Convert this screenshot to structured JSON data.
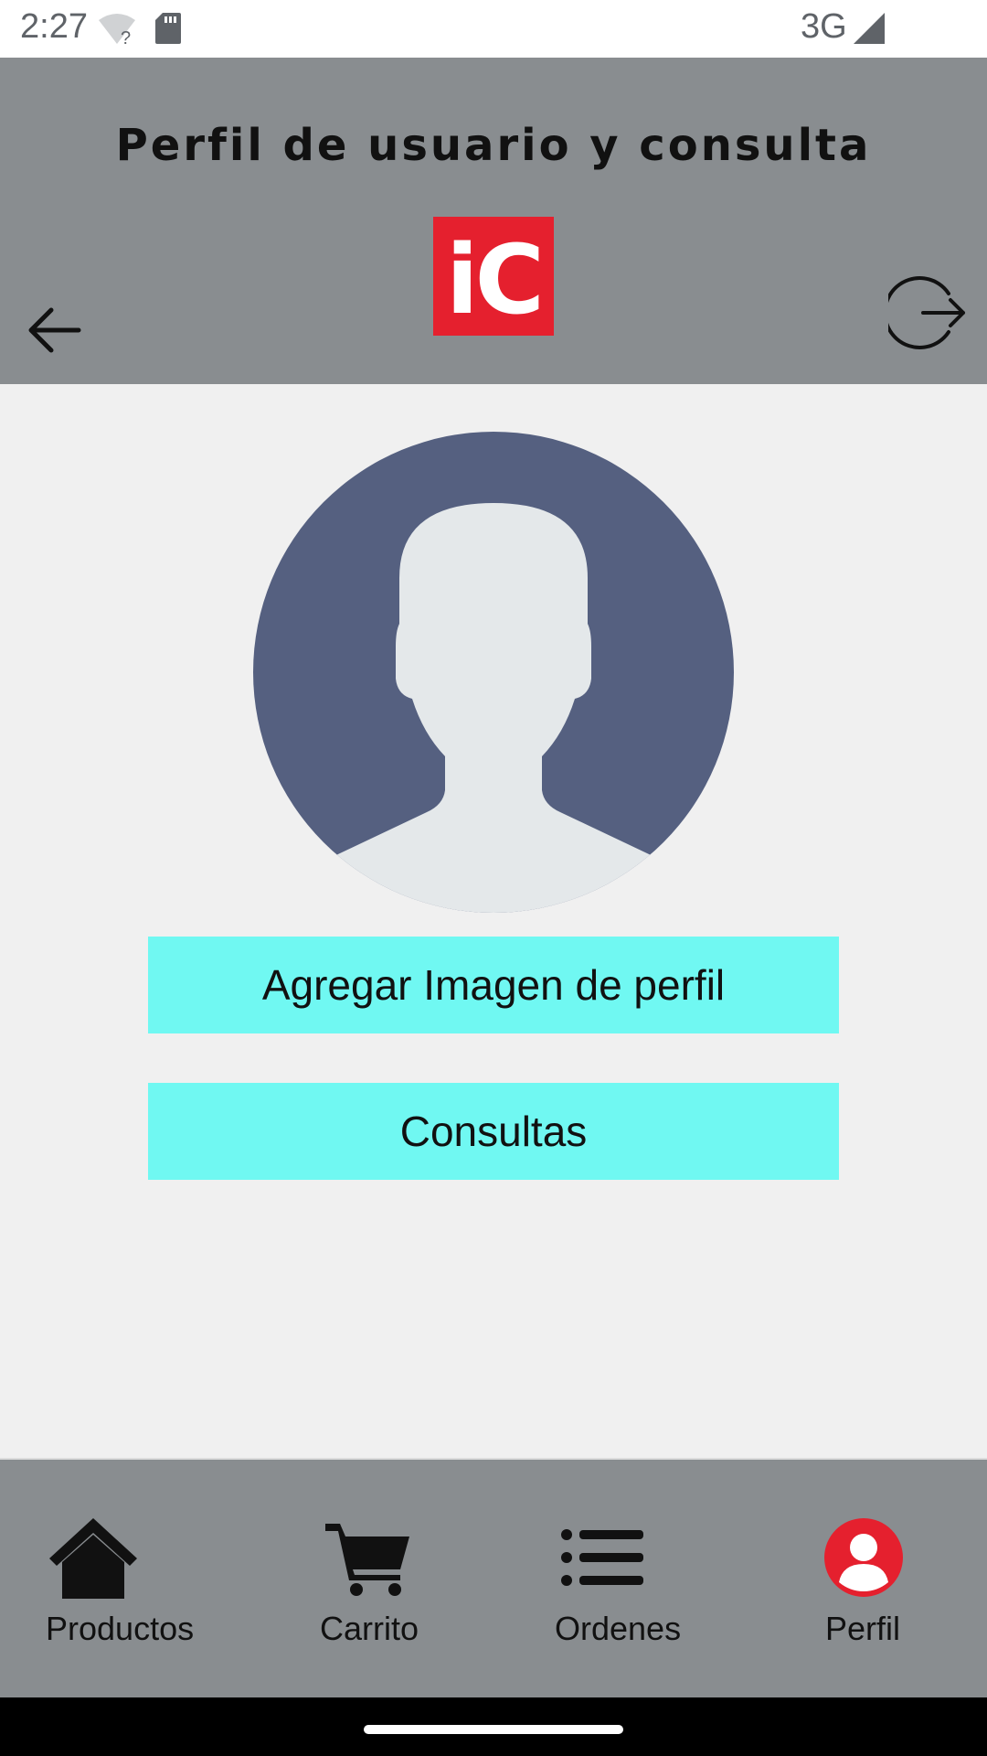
{
  "status_bar": {
    "time": "2:27",
    "network": "3G",
    "icons": [
      "wifi-unknown-icon",
      "sd-card-icon",
      "signal-icon"
    ]
  },
  "header": {
    "title": "Perfil de usuario y consulta",
    "logo_text": "iC",
    "back_icon": "arrow-left-icon",
    "logout_icon": "logout-icon"
  },
  "profile": {
    "avatar_icon": "default-user-avatar"
  },
  "buttons": {
    "add_image": "Agregar Imagen de perfil",
    "consultas": "Consultas"
  },
  "bottom_nav": {
    "items": [
      {
        "label": "Productos",
        "icon": "home-icon",
        "active": false
      },
      {
        "label": "Carrito",
        "icon": "cart-icon",
        "active": false
      },
      {
        "label": "Ordenes",
        "icon": "list-icon",
        "active": false
      },
      {
        "label": "Perfil",
        "icon": "user-circle-icon",
        "active": true
      }
    ]
  },
  "colors": {
    "header_bg": "#898d90",
    "content_bg": "#f0f0f0",
    "button_bg": "#70f8f2",
    "brand_red": "#e5202e",
    "avatar_bg": "#556080",
    "avatar_fg": "#e4e8ea",
    "active_nav": "#e5202e"
  }
}
